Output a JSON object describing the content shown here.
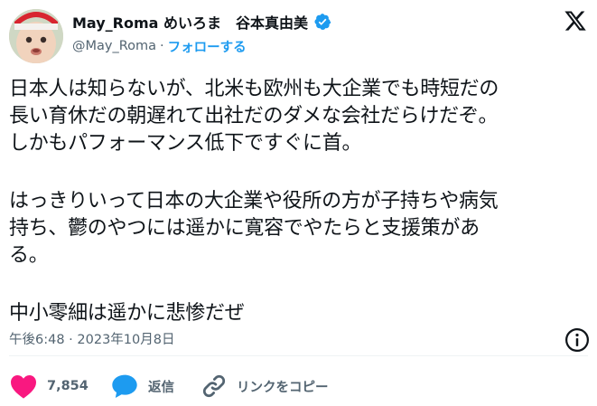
{
  "author": {
    "display_name": "May_Roma めいろま　谷本真由美",
    "handle": "@May_Roma",
    "separator": "·",
    "follow_label": "フォローする"
  },
  "tweet": {
    "lines_p1": [
      "日本人は知らないが、北米も欧州も大企業でも時短だの",
      "長い育休だの朝遅れて出社だのダメな会社だらけだぞ。",
      "しかもパフォーマンス低下ですぐに首。"
    ],
    "lines_p2": [
      "はっきりいって日本の大企業や役所の方が子持ちや病気",
      "持ち、鬱のやつには遥かに寛容でやたらと支援策があ",
      "る。"
    ],
    "lines_p3": [
      "中小零細は遥かに悲惨だぜ"
    ],
    "timestamp": "午後6:48 · 2023年10月8日"
  },
  "actions": {
    "like_count": "7,854",
    "reply_label": "返信",
    "copy_link_label": "リンクをコピー"
  },
  "icons": {
    "verified": "verified-badge-icon",
    "logo": "x-logo-icon",
    "info": "info-icon",
    "like": "heart-icon",
    "reply": "speech-bubble-icon",
    "link": "link-icon"
  },
  "colors": {
    "accent": "#1d9bf0",
    "like": "#f91880",
    "muted": "#536471",
    "text": "#0f1419"
  }
}
